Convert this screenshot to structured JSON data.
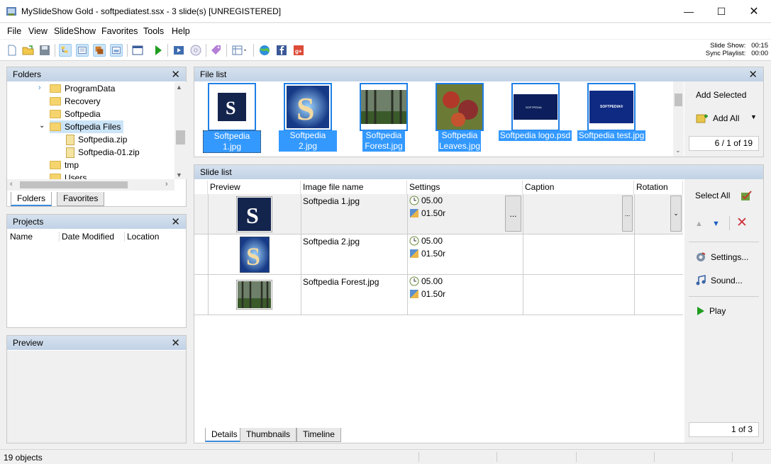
{
  "window": {
    "title": "MySlideShow Gold - softpediatest.ssx - 3 slide(s)   [UNREGISTERED]"
  },
  "menu": [
    "File",
    "View",
    "SlideShow",
    "Favorites",
    "Tools",
    "Help"
  ],
  "timings": {
    "slide_show_label": "Slide Show:",
    "slide_show_value": "00:15",
    "sync_playlist_label": "Sync Playlist:",
    "sync_playlist_value": "00:00"
  },
  "folders": {
    "title": "Folders",
    "items": [
      {
        "label": "ProgramData",
        "type": "folder"
      },
      {
        "label": "Recovery",
        "type": "folder"
      },
      {
        "label": "Softpedia",
        "type": "folder"
      },
      {
        "label": "Softpedia Files",
        "type": "folder"
      },
      {
        "label": "Softpedia.zip",
        "type": "zip"
      },
      {
        "label": "Softpedia-01.zip",
        "type": "zip"
      },
      {
        "label": "tmp",
        "type": "folder"
      },
      {
        "label": "Users",
        "type": "folder"
      }
    ],
    "tabs": [
      "Folders",
      "Favorites"
    ]
  },
  "projects": {
    "title": "Projects",
    "columns": [
      "Name",
      "Date Modified",
      "Location"
    ]
  },
  "preview": {
    "title": "Preview"
  },
  "file_list": {
    "title": "File list",
    "files": [
      {
        "name": "Softpedia 1.jpg",
        "lines": [
          "Softpedia 1.jpg"
        ]
      },
      {
        "name": "Softpedia 2.jpg",
        "lines": [
          "Softpedia 2.jpg"
        ]
      },
      {
        "name": "Softpedia Forest.jpg",
        "lines": [
          "Softpedia",
          "Forest.jpg"
        ]
      },
      {
        "name": "Softpedia Leaves.jpg",
        "lines": [
          "Softpedia",
          "Leaves.jpg"
        ]
      },
      {
        "name": "Softpedia logo.psd",
        "lines": [
          "Softpedia logo.psd"
        ]
      },
      {
        "name": "Softpedia test.jpg",
        "lines": [
          "Softpedia test.jpg"
        ]
      }
    ],
    "add_selected": "Add Selected",
    "add_all": "Add All",
    "page": "6 / 1 of 19"
  },
  "slide_list": {
    "title": "Slide list",
    "columns": [
      "Preview",
      "Image file name",
      "Settings",
      "Caption",
      "Rotation"
    ],
    "rows": [
      {
        "file": "Softpedia 1.jpg",
        "duration": "05.00",
        "transition": "01.50r"
      },
      {
        "file": "Softpedia 2.jpg",
        "duration": "05.00",
        "transition": "01.50r"
      },
      {
        "file": "Softpedia Forest.jpg",
        "duration": "05.00",
        "transition": "01.50r"
      }
    ],
    "select_all": "Select All",
    "settings": "Settings...",
    "sound": "Sound...",
    "play": "Play",
    "page": "1 of 3",
    "ellipsis": "...",
    "tabs": [
      "Details",
      "Thumbnails",
      "Timeline"
    ]
  },
  "thumb_texts": {
    "logo": "SOFTPEDIA",
    "test": "SOFTPEDIA®"
  },
  "status": {
    "objects": "19 objects"
  }
}
